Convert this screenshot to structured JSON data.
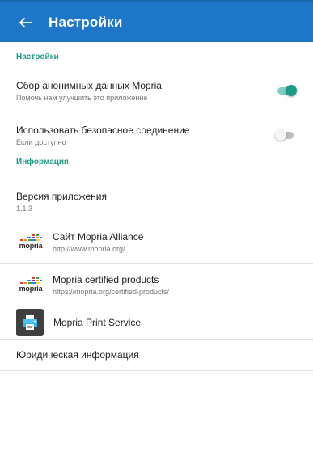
{
  "appbar": {
    "title": "Настройки",
    "color": "#1e77c6"
  },
  "sections": {
    "settings_header": "Настройки",
    "info_header": "Информация",
    "header_color": "#1e9a86"
  },
  "prefs": {
    "anon": {
      "title": "Сбор анонимных данных Mopria",
      "subtitle": "Помочь нам улучшить это приложение",
      "enabled": true
    },
    "secure": {
      "title": "Использовать безопасное соединение",
      "subtitle": "Если доступно",
      "enabled": false
    }
  },
  "info": {
    "version_label": "Версия приложения",
    "version_value": "1.1.3",
    "links": [
      {
        "title": "Сайт Mopria Alliance",
        "subtitle": "http://www.mopria.org/",
        "logo_text": "mopria"
      },
      {
        "title": "Mopria certified products",
        "subtitle": "https://mopria.org/certified-products/",
        "logo_text": "mopria"
      }
    ],
    "print_service": "Mopria Print Service",
    "legal": "Юридическая информация"
  },
  "icons": {
    "back": "arrow-left-icon",
    "logo": "mopria-logo-icon",
    "printer": "printer-icon"
  }
}
